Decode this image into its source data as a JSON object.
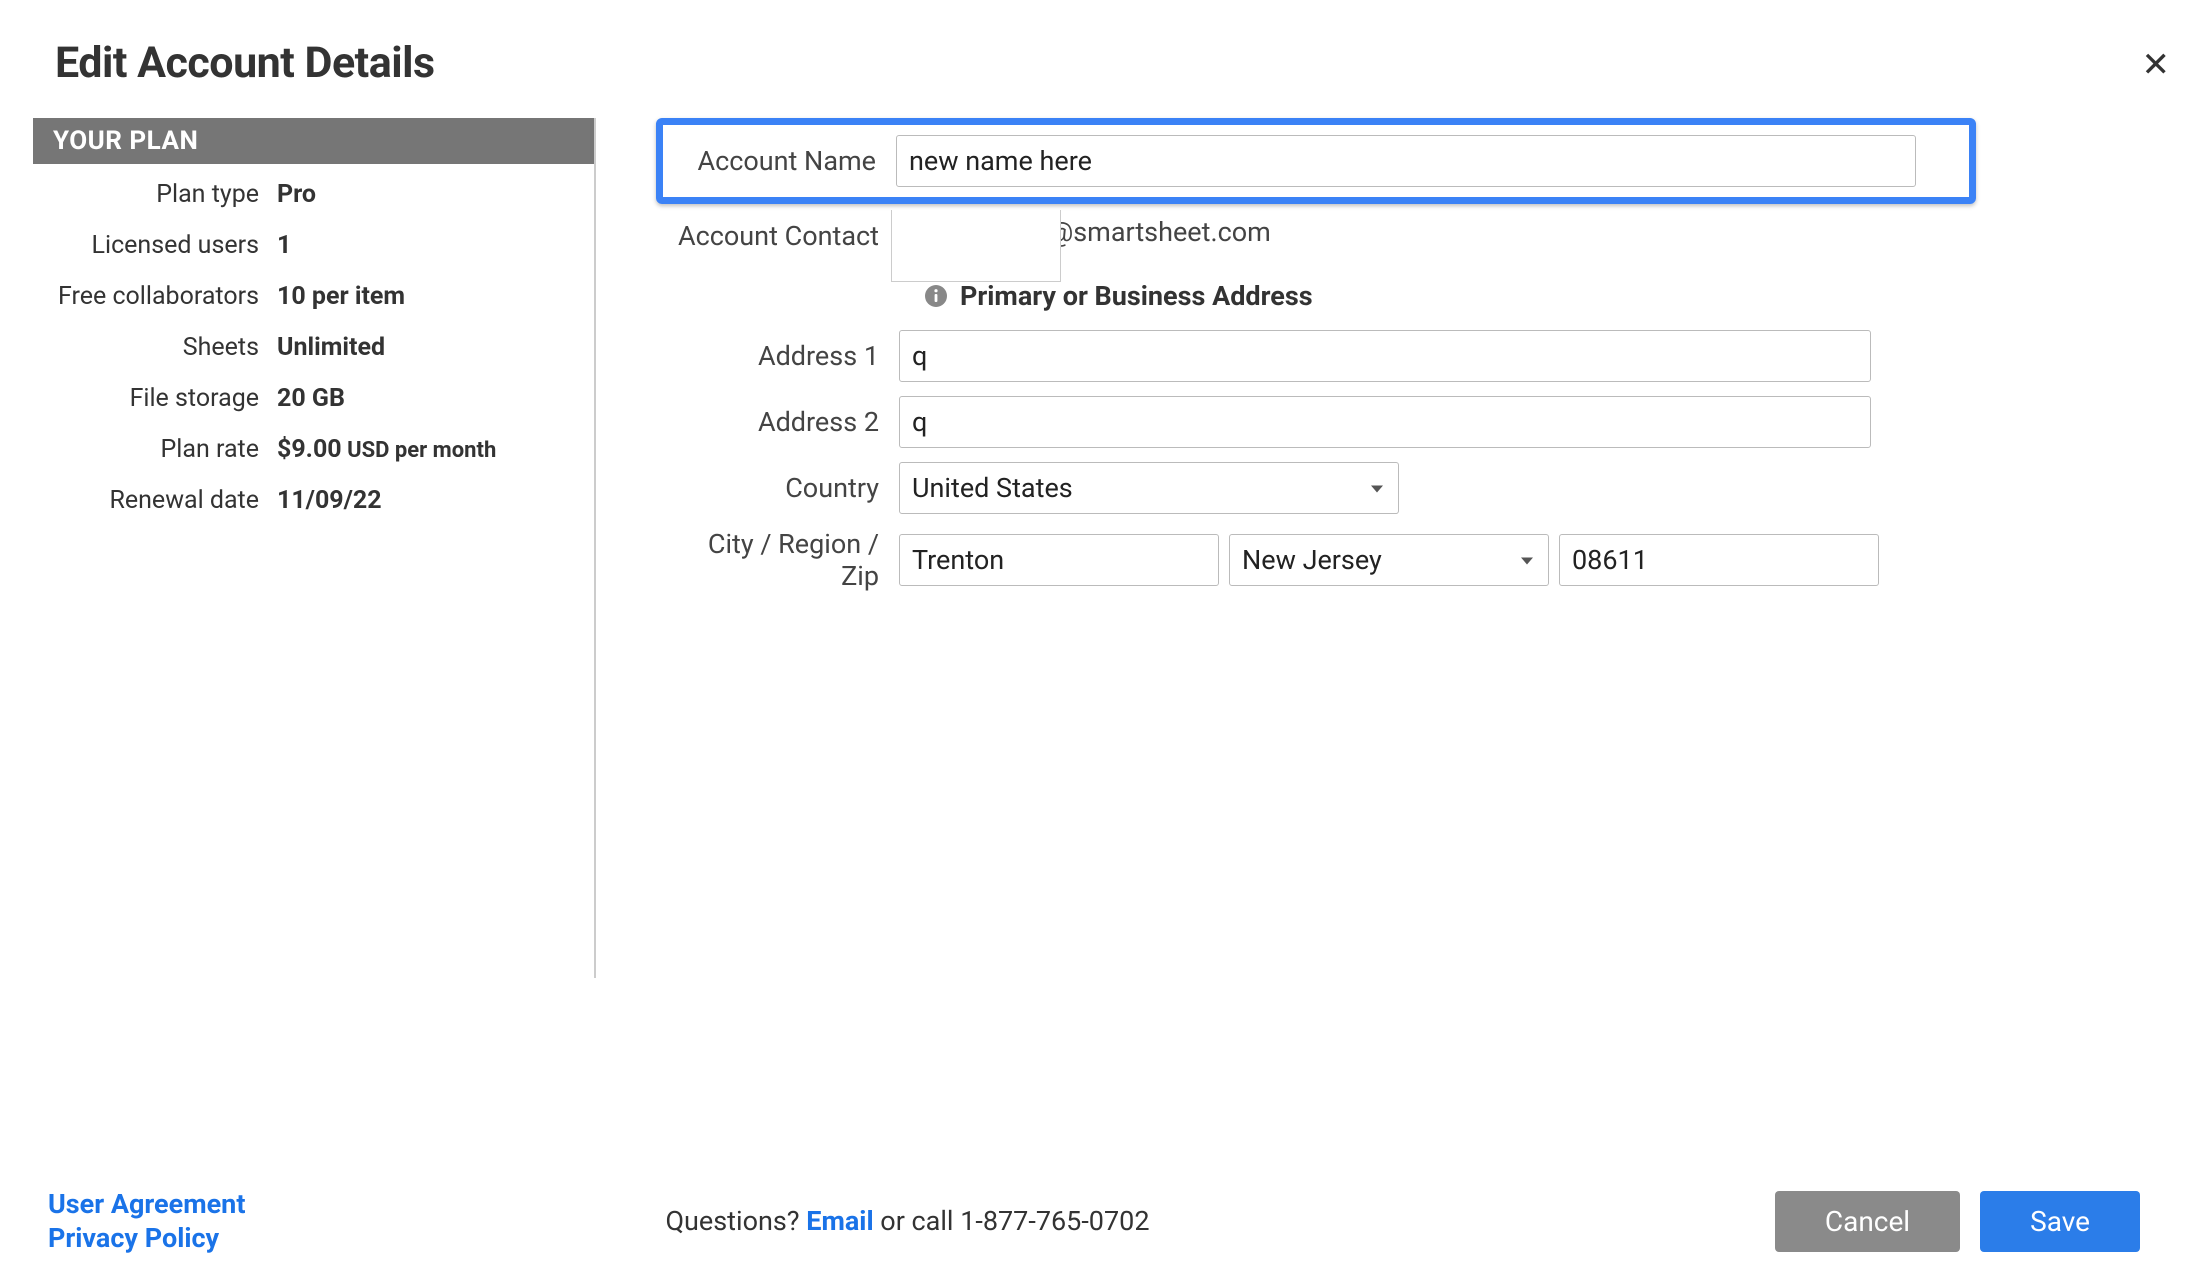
{
  "header": {
    "title": "Edit Account Details"
  },
  "sidebar": {
    "section_title": "YOUR PLAN",
    "rows": {
      "plan_type": {
        "label": "Plan type",
        "value": "Pro"
      },
      "licensed_users": {
        "label": "Licensed users",
        "value": "1"
      },
      "free_collaborators": {
        "label": "Free collaborators",
        "value": "10 per item"
      },
      "sheets": {
        "label": "Sheets",
        "value": "Unlimited"
      },
      "file_storage": {
        "label": "File storage",
        "value": "20 GB"
      },
      "plan_rate": {
        "label": "Plan rate",
        "value": "$9.00",
        "suffix": " USD per month"
      },
      "renewal_date": {
        "label": "Renewal date",
        "value": "11/09/22"
      }
    }
  },
  "form": {
    "account_name": {
      "label": "Account Name",
      "value": "new name here"
    },
    "account_contact": {
      "label": "Account Contact",
      "value": "@smartsheet.com"
    },
    "address_section": "Primary or Business Address",
    "address1": {
      "label": "Address 1",
      "value": "q"
    },
    "address2": {
      "label": "Address 2",
      "value": "q"
    },
    "country": {
      "label": "Country",
      "value": "United States"
    },
    "city_region_zip": {
      "label": "City / Region / Zip",
      "city": "Trenton",
      "region": "New Jersey",
      "zip": "08611"
    }
  },
  "footer": {
    "links": {
      "user_agreement": "User Agreement",
      "privacy_policy": "Privacy Policy"
    },
    "questions_prefix": "Questions? ",
    "email_text": "Email",
    "questions_suffix": " or call 1-877-765-0702",
    "cancel": "Cancel",
    "save": "Save"
  }
}
